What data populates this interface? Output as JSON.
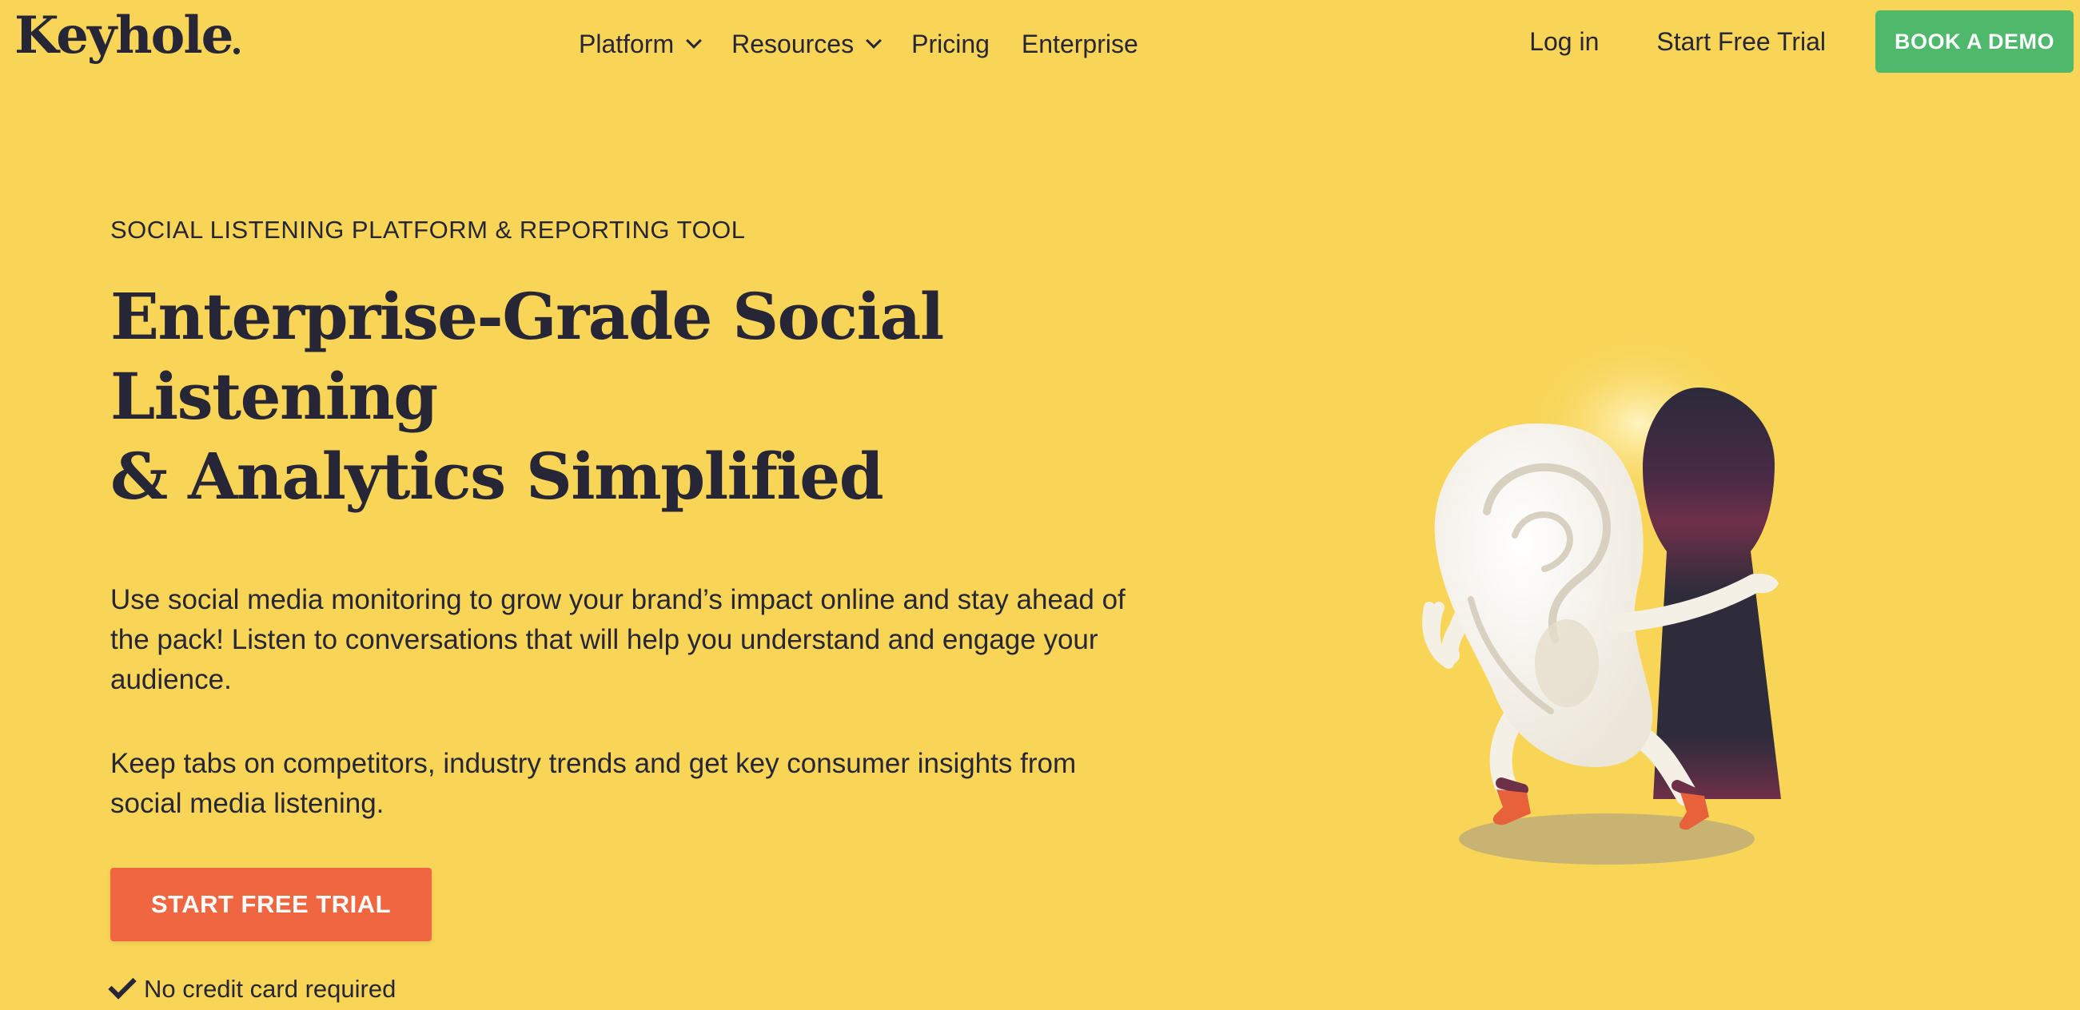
{
  "brand": {
    "logo_text": "Keyhole"
  },
  "nav": {
    "items": [
      {
        "label": "Platform",
        "has_dropdown": true
      },
      {
        "label": "Resources",
        "has_dropdown": true
      },
      {
        "label": "Pricing",
        "has_dropdown": false
      },
      {
        "label": "Enterprise",
        "has_dropdown": false
      }
    ],
    "login_label": "Log in",
    "trial_label": "Start Free Trial",
    "demo_label": "BOOK A DEMO"
  },
  "hero": {
    "eyebrow": "SOCIAL LISTENING PLATFORM & REPORTING TOOL",
    "headline_line1": "Enterprise-Grade Social Listening",
    "headline_line2": "& Analytics Simplified",
    "paragraph1": "Use social media monitoring to grow your brand’s impact online and stay ahead of the pack! Listen to conversations that will help you understand and engage your audience.",
    "paragraph2": "Keep tabs on competitors, industry trends and get key consumer insights from social media listening.",
    "cta_label": "START FREE TRIAL",
    "note": "No credit card required"
  },
  "colors": {
    "background": "#f8d557",
    "text": "#262637",
    "demo_button": "#4eb86b",
    "cta_button": "#ef6640"
  },
  "icons": {
    "dropdown": "chevron-down-icon",
    "check": "check-icon"
  }
}
